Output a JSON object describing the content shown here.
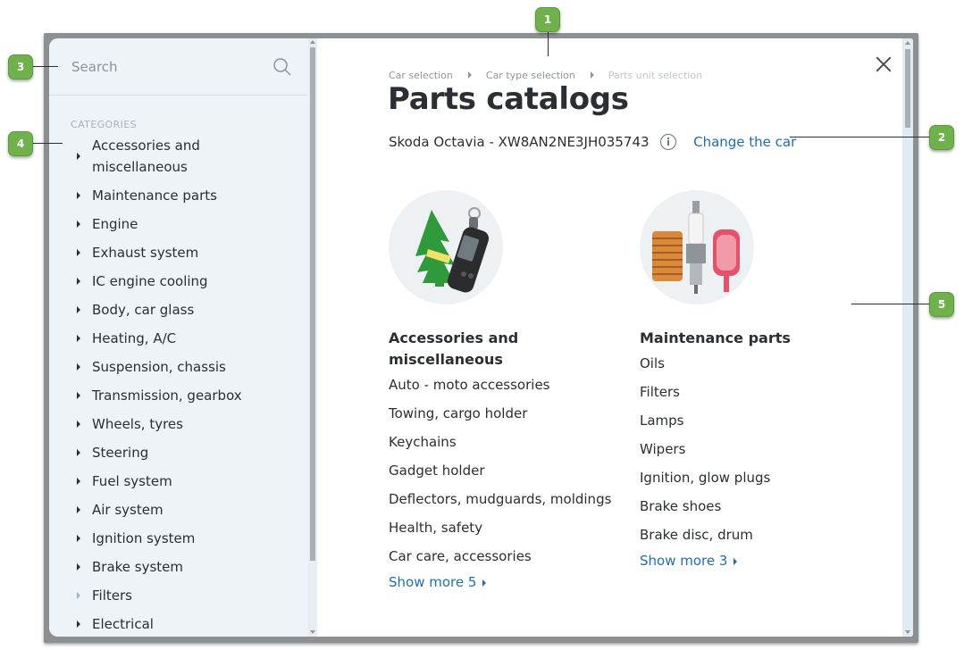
{
  "sidebar": {
    "search_placeholder": "Search",
    "categories_heading": "CATEGORIES",
    "items": [
      {
        "label": "Accessories and miscellaneous"
      },
      {
        "label": "Maintenance parts"
      },
      {
        "label": "Engine"
      },
      {
        "label": "Exhaust system"
      },
      {
        "label": "IC engine cooling"
      },
      {
        "label": "Body, car glass"
      },
      {
        "label": "Heating, A/C"
      },
      {
        "label": "Suspension, chassis"
      },
      {
        "label": "Transmission, gearbox"
      },
      {
        "label": "Wheels, tyres"
      },
      {
        "label": "Steering"
      },
      {
        "label": "Fuel system"
      },
      {
        "label": "Air system"
      },
      {
        "label": "Ignition system"
      },
      {
        "label": "Brake system"
      },
      {
        "label": "Filters"
      },
      {
        "label": "Electrical"
      }
    ]
  },
  "main": {
    "breadcrumb": {
      "items": [
        "Car selection",
        "Car type selection"
      ],
      "current": "Parts unit selection"
    },
    "title": "Parts catalogs",
    "car_name": "Skoda Octavia - XW8AN2NE3JH035743",
    "change_car_label": "Change the car",
    "categories": [
      {
        "title": "Accessories and miscellaneous",
        "items": [
          "Auto - moto accessories",
          "Towing, cargo holder",
          "Keychains",
          "Gadget holder",
          "Deflectors, mudguards, moldings",
          "Health, safety",
          "Car care, accessories"
        ],
        "show_more": "Show more 5"
      },
      {
        "title": "Maintenance parts",
        "items": [
          "Oils",
          "Filters",
          "Lamps",
          "Wipers",
          "Ignition, glow plugs",
          "Brake shoes",
          "Brake disc, drum"
        ],
        "show_more": "Show more 3"
      }
    ]
  },
  "callouts": [
    "1",
    "2",
    "3",
    "4",
    "5"
  ],
  "colors": {
    "accent_link": "#1f6fae",
    "callout_green": "#6fb24b",
    "sidebar_bg": "#eef3f7"
  }
}
